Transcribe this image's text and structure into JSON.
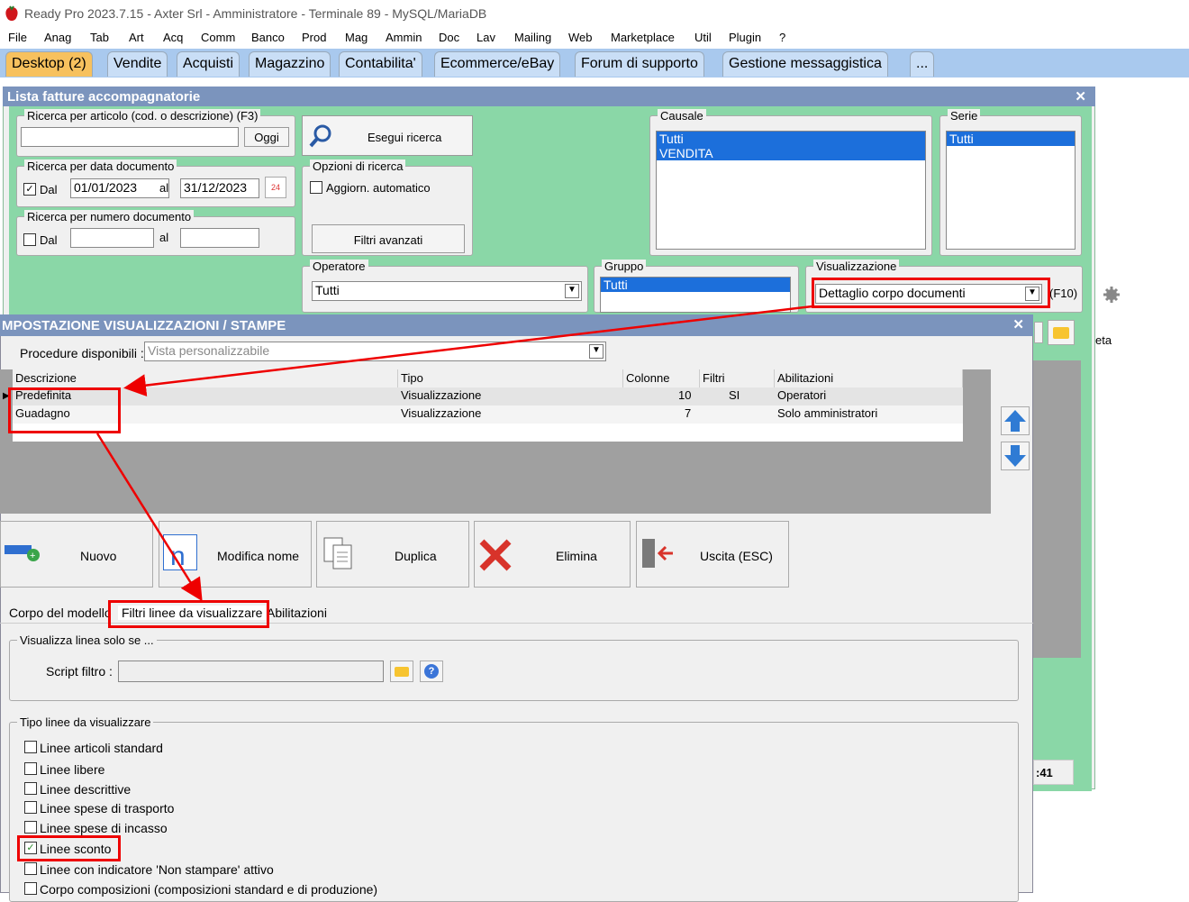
{
  "app": {
    "title": "Ready Pro 2023.7.15 - Axter Srl - Amministratore - Terminale 89 - MySQL/MariaDB"
  },
  "menu": [
    "File",
    "Anag",
    "Tab",
    "Art",
    "Acq",
    "Comm",
    "Banco",
    "Prod",
    "Mag",
    "Ammin",
    "Doc",
    "Lav",
    "Mailing",
    "Web",
    "Marketplace",
    "Util",
    "Plugin",
    "?"
  ],
  "tabs": [
    "Desktop (2)",
    "Vendite",
    "Acquisti",
    "Magazzino",
    "Contabilita'",
    "Ecommerce/eBay",
    "Forum di supporto",
    "Gestione messaggistica",
    "..."
  ],
  "lista": {
    "title": "Lista fatture accompagnatorie",
    "ricerca_articolo": {
      "legend": "Ricerca per articolo (cod. o descrizione) (F3)",
      "value": "",
      "oggi": "Oggi"
    },
    "ricerca_data": {
      "legend": "Ricerca per data documento",
      "dal_label": "Dal",
      "dal_checked": true,
      "from": "01/01/2023",
      "al": "al",
      "to": "31/12/2023"
    },
    "ricerca_numero": {
      "legend": "Ricerca per numero documento",
      "dal_label": "Dal",
      "al": "al"
    },
    "esegui": "Esegui ricerca",
    "opzioni": {
      "legend": "Opzioni di ricerca",
      "aggiorn": "Aggiorn. automatico",
      "filtri": "Filtri avanzati"
    },
    "causale": {
      "legend": "Causale",
      "items": [
        "Tutti",
        "VENDITA"
      ]
    },
    "serie": {
      "legend": "Serie",
      "items": [
        "Tutti"
      ]
    },
    "operatore": {
      "legend": "Operatore",
      "value": "Tutti"
    },
    "gruppo": {
      "legend": "Gruppo",
      "items": [
        "Tutti"
      ]
    },
    "visualizzazione": {
      "legend": "Visualizzazione",
      "value": "Dettaglio corpo documenti",
      "hint": "(F10)"
    },
    "side_text": "eta",
    "status": ":41"
  },
  "dialog": {
    "title": "MPOSTAZIONE VISUALIZZAZIONI / STAMPE",
    "procedure_label": "Procedure disponibili :",
    "procedure_value": "Vista personalizzabile",
    "columns": [
      "Descrizione",
      "Tipo",
      "Colonne",
      "Filtri",
      "Abilitazioni"
    ],
    "rows": [
      {
        "descrizione": "Predefinita",
        "tipo": "Visualizzazione",
        "colonne": "10",
        "filtri": "SI",
        "abilitazioni": "Operatori"
      },
      {
        "descrizione": "Guadagno",
        "tipo": "Visualizzazione",
        "colonne": "7",
        "filtri": "",
        "abilitazioni": "Solo amministratori"
      }
    ],
    "buttons": {
      "nuovo": "Nuovo",
      "modifica": "Modifica nome",
      "duplica": "Duplica",
      "elimina": "Elimina",
      "uscita": "Uscita (ESC)"
    },
    "subtabs": [
      "Corpo del modello",
      "Filtri linee da visualizzare",
      "Abilitazioni"
    ],
    "visualizza": {
      "legend": "Visualizza linea solo se ...",
      "script_label": "Script filtro :",
      "script_value": ""
    },
    "tipo_linee": {
      "legend": "Tipo linee da visualizzare",
      "items": [
        {
          "label": "Linee articoli standard",
          "checked": false
        },
        {
          "label": "Linee libere",
          "checked": false
        },
        {
          "label": "Linee descrittive",
          "checked": false
        },
        {
          "label": "Linee spese di trasporto",
          "checked": false
        },
        {
          "label": "Linee spese di incasso",
          "checked": false
        },
        {
          "label": "Linee sconto",
          "checked": true
        },
        {
          "label": "Linee con indicatore 'Non stampare' attivo",
          "checked": false
        },
        {
          "label": "Corpo composizioni (composizioni standard e di produzione)",
          "checked": false
        }
      ]
    }
  },
  "colors": {
    "accent_red": "#e00000",
    "tab_active": "#f7c15e",
    "title_blue": "#7b94bd",
    "green_panel": "#8ad7a7",
    "selection": "#1c6fdb"
  }
}
